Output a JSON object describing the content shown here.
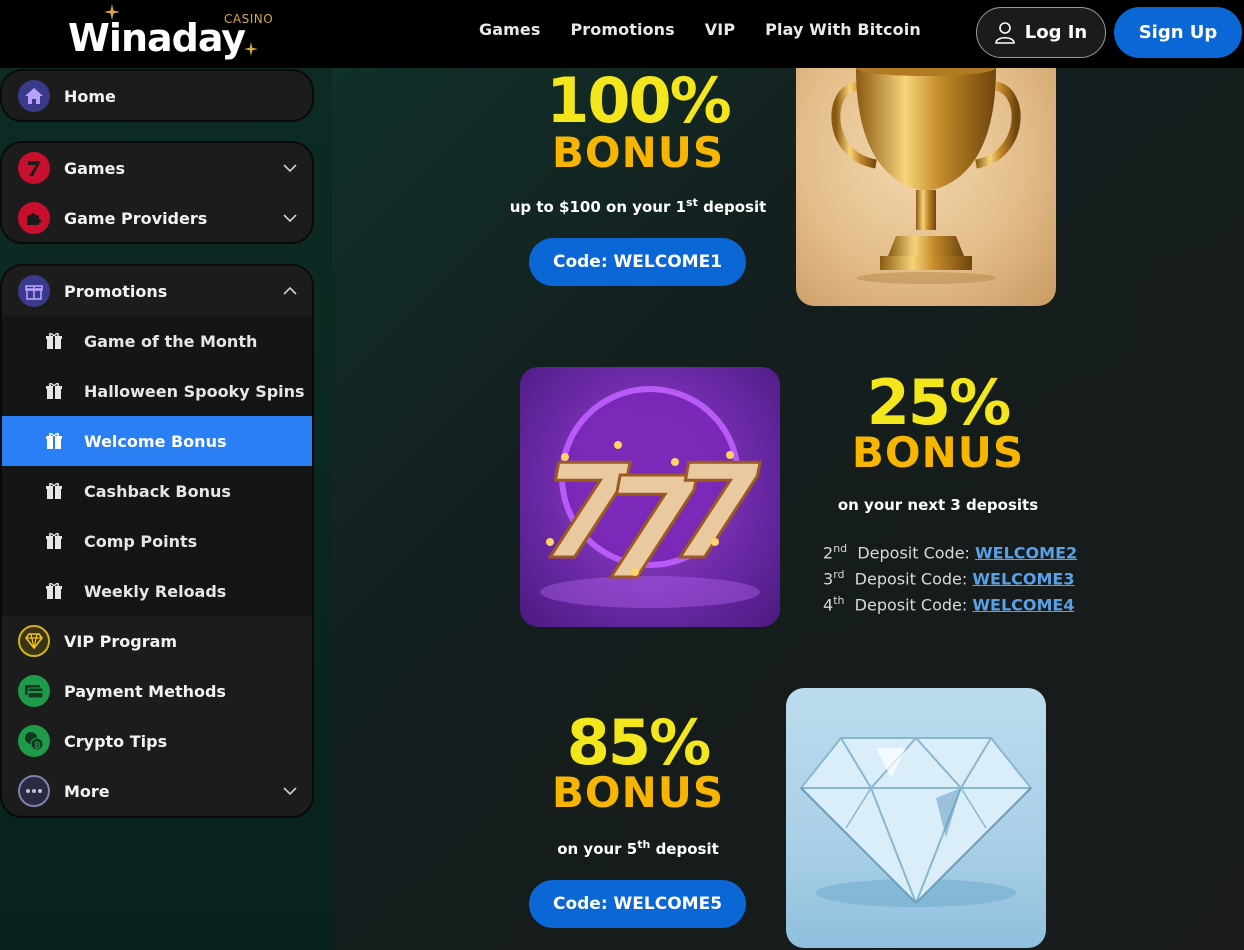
{
  "header": {
    "logo_text": "Winaday",
    "logo_casino": "CASINO",
    "nav": [
      "Games",
      "Promotions",
      "VIP",
      "Play With Bitcoin"
    ],
    "login_label": "Log In",
    "signup_label": "Sign Up"
  },
  "sidebar": {
    "home": "Home",
    "games": "Games",
    "providers": "Game Providers",
    "promotions": "Promotions",
    "promo_items": [
      "Game of the Month",
      "Halloween Spooky Spins",
      "Welcome Bonus",
      "Cashback Bonus",
      "Comp Points",
      "Weekly Reloads"
    ],
    "active_promo": "Welcome Bonus",
    "vip": "VIP Program",
    "payment": "Payment Methods",
    "crypto": "Crypto Tips",
    "more": "More"
  },
  "promos": [
    {
      "percent": "100%",
      "bonus": "BONUS",
      "subtitle_pre": "up to $100 on your 1",
      "subtitle_sup": "st",
      "subtitle_post": " deposit",
      "code": "Code: WELCOME1",
      "image": "gold-trophy"
    },
    {
      "percent": "25%",
      "bonus": "BONUS",
      "subtitle": "on your next 3 deposits",
      "deposits": [
        {
          "n": "2",
          "sup": "nd",
          "label": "Deposit Code:",
          "code": "WELCOME2"
        },
        {
          "n": "3",
          "sup": "rd",
          "label": "Deposit Code:",
          "code": "WELCOME3"
        },
        {
          "n": "4",
          "sup": "th",
          "label": "Deposit Code:",
          "code": "WELCOME4"
        }
      ],
      "image": "slot-777"
    },
    {
      "percent": "85%",
      "bonus": "BONUS",
      "subtitle_pre": "on your 5",
      "subtitle_sup": "th",
      "subtitle_post": " deposit",
      "code": "Code: WELCOME5",
      "image": "diamond"
    }
  ],
  "colors": {
    "accent_blue": "#0b66d6",
    "active_blue": "#2b7ff5",
    "yellow": "#f3e61c",
    "gold": "#f7b500"
  }
}
